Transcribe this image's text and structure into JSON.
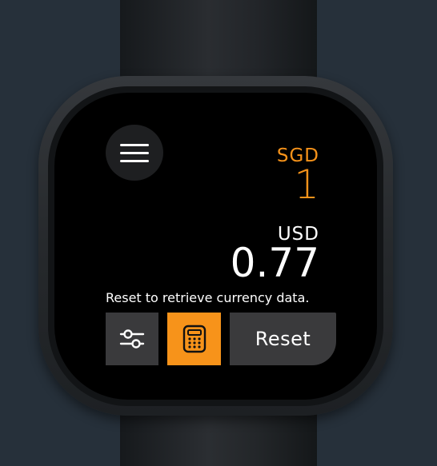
{
  "converter": {
    "from_currency": "SGD",
    "from_amount": "1",
    "to_currency": "USD",
    "to_amount": "0.77"
  },
  "status_message": "Reset to retrieve currency data.",
  "buttons": {
    "menu_icon": "hamburger-menu-icon",
    "settings_icon": "sliders-icon",
    "calculator_icon": "calculator-icon",
    "reset_label": "Reset"
  },
  "colors": {
    "accent": "#f7931a",
    "screen_background": "#000000",
    "button_background": "#3a3a3c",
    "page_background": "#26303a"
  }
}
